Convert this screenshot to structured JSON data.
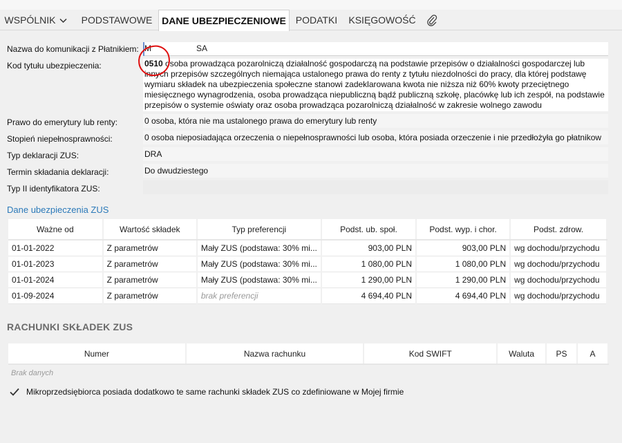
{
  "tabs": [
    {
      "label": "WSPÓLNIK"
    },
    {
      "label": "PODSTAWOWE"
    },
    {
      "label": "DANE UBEZPIECZENIOWE"
    },
    {
      "label": "PODATKI"
    },
    {
      "label": "KSIĘGOWOŚĆ"
    }
  ],
  "fields": {
    "name_label": "Nazwa do komunikacji z Płatnikiem:",
    "name_value_start": "M",
    "name_value_end": "SA",
    "kod_label": "Kod tytułu ubezpieczenia:",
    "kod_code": "0510",
    "kod_text": " osoba prowadząca pozarolniczą działalność gospodarczą na podstawie przepisów o działalności gospodarczej lub innych przepisów szczególnych niemająca ustalonego prawa do renty z tytułu niezdolności do pracy, dla której podstawę wymiaru składek na ubezpieczenia społeczne stanowi zadeklarowana kwota nie niższa niż 60% kwoty przeciętnego miesięcznego wynagrodzenia, osoba prowadząca niepubliczną bądź publiczną szkołę, placówkę lub ich zespół, na podstawie przepisów o systemie oświaty oraz osoba prowadząca pozarolniczą działalność w zakresie wolnego zawodu",
    "emerytura_label": "Prawo do emerytury lub renty:",
    "emerytura_value": "0  osoba, która nie ma ustalonego prawa do emerytury lub renty",
    "niepelno_label": "Stopień niepełnosprawności:",
    "niepelno_value": "0  osoba nieposiadająca orzeczenia o niepełnosprawności lub osoba, która posiada orzeczenie i nie przedłożyła go płatnikow",
    "deklaracja_label": "Typ deklaracji ZUS:",
    "deklaracja_value": "DRA",
    "termin_label": "Termin składania deklaracji:",
    "termin_value": "Do dwudziestego",
    "identyfikator_label": "Typ II identyfikatora ZUS:",
    "identyfikator_value": ""
  },
  "section_link": "Dane ubezpieczenia ZUS",
  "zus_table": {
    "headers": [
      "Ważne od",
      "Wartość składek",
      "Typ preferencji",
      "Podst. ub. społ.",
      "Podst. wyp. i chor.",
      "Podst. zdrow."
    ],
    "rows": [
      [
        "01-01-2022",
        "Z parametrów",
        "Mały ZUS (podstawa: 30% mi...",
        "903,00 PLN",
        "903,00 PLN",
        "wg dochodu/przychodu"
      ],
      [
        "01-01-2023",
        "Z parametrów",
        "Mały ZUS (podstawa: 30% mi...",
        "1 080,00 PLN",
        "1 080,00 PLN",
        "wg dochodu/przychodu"
      ],
      [
        "01-01-2024",
        "Z parametrów",
        "Mały ZUS (podstawa: 30% mi...",
        "1 290,00 PLN",
        "1 290,00 PLN",
        "wg dochodu/przychodu"
      ],
      [
        "01-09-2024",
        "Z parametrów",
        "brak preferencji",
        "4 694,40 PLN",
        "4 694,40 PLN",
        "wg dochodu/przychodu"
      ]
    ]
  },
  "accounts": {
    "title": "RACHUNKI SKŁADEK ZUS",
    "headers": [
      "Numer",
      "Nazwa rachunku",
      "Kod SWIFT",
      "Waluta",
      "PS",
      "A"
    ],
    "empty_text": "Brak danych"
  },
  "checkbox": {
    "label": "Mikroprzedsiębiorca posiada dodatkowo te same rachunki składek ZUS co zdefiniowane w Mojej firmie",
    "checked": true
  },
  "colors": {
    "accent": "#2b79b9",
    "annotation": "#e01010"
  }
}
